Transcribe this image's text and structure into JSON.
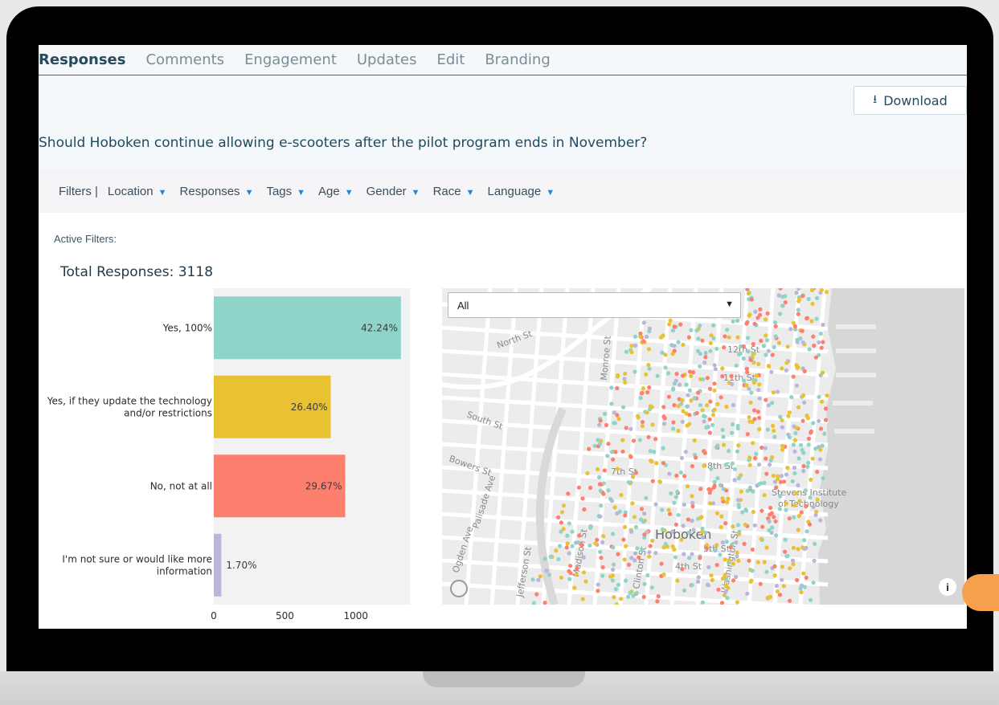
{
  "tabs": [
    "Responses",
    "Comments",
    "Engagement",
    "Updates",
    "Edit",
    "Branding"
  ],
  "download_label": "Download",
  "question": "Should Hoboken continue allowing e-scooters after the pilot program ends in November?",
  "filters": {
    "label": "Filters |",
    "items": [
      "Location",
      "Responses",
      "Tags",
      "Age",
      "Gender",
      "Race",
      "Language"
    ]
  },
  "active_filters_label": "Active Filters:",
  "total_responses_label": "Total Responses: 3118",
  "colors": {
    "teal": "#8fd4c8",
    "yellow": "#e9c233",
    "salmon": "#fd806f",
    "lavender": "#b9b6da",
    "map_water": "#d7d7d8",
    "map_land": "#ececec"
  },
  "chart_data": {
    "type": "bar",
    "orientation": "horizontal",
    "categories": [
      "Yes, 100%",
      "Yes, if they update the technology and/or restrictions",
      "No, not at all",
      "I'm not sure or would like more information"
    ],
    "values": [
      1317,
      823,
      925,
      53
    ],
    "data_labels": [
      "42.24%",
      "26.40%",
      "29.67%",
      "1.70%"
    ],
    "colors": [
      "#8fd4c8",
      "#e9c233",
      "#fd806f",
      "#b9b6da"
    ],
    "x_ticks": [
      0,
      500,
      1000
    ],
    "xlim": [
      0,
      1380
    ],
    "grid": false
  },
  "map": {
    "select_value": "All",
    "labels": [
      "North St",
      "South St",
      "Bowers St",
      "Palisade Ave",
      "Ogden Ave",
      "Monroe St",
      "12th St",
      "11th St",
      "8th St",
      "7th St",
      "5th St",
      "4th St",
      "Hoboken",
      "Stevens Institute",
      "of Technology",
      "Madison St",
      "Clinton St",
      "Washington St",
      "Jefferson St"
    ]
  }
}
